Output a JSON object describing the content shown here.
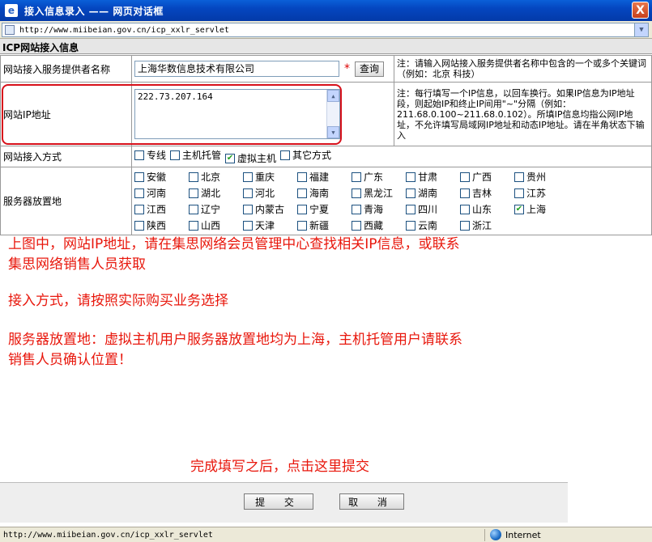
{
  "window": {
    "title": "接入信息录入  —— 网页对话框",
    "close_glyph": "X"
  },
  "address": {
    "url": "http://www.miibeian.gov.cn/icp_xxlr_servlet"
  },
  "form": {
    "section_title": "ICP网站接入信息",
    "provider": {
      "label": "网站接入服务提供者名称",
      "value": "上海华数信息技术有限公司",
      "required_mark": "*",
      "query_button": "查询",
      "note": "注：请输入网站接入服务提供者名称中包含的一个或多个关键词（例如：北京 科技）"
    },
    "ip": {
      "label": "网站IP地址",
      "value": "222.73.207.164",
      "note": "注：每行填写一个IP信息，以回车换行。如果IP信息为IP地址段，则起始IP和终止IP间用\"~\"分隔（例如：211.68.0.100~211.68.0.102）。所填IP信息均指公网IP地址，不允许填写局域网IP地址和动态IP地址。请在半角状态下输入"
    },
    "access_method": {
      "label": "网站接入方式",
      "options": [
        {
          "label": "专线",
          "checked": false
        },
        {
          "label": "主机托管",
          "checked": false
        },
        {
          "label": "虚拟主机",
          "checked": true
        },
        {
          "label": "其它方式",
          "checked": false
        }
      ]
    },
    "server_location": {
      "label": "服务器放置地",
      "options": [
        {
          "label": "安徽",
          "checked": false
        },
        {
          "label": "北京",
          "checked": false
        },
        {
          "label": "重庆",
          "checked": false
        },
        {
          "label": "福建",
          "checked": false
        },
        {
          "label": "广东",
          "checked": false
        },
        {
          "label": "甘肃",
          "checked": false
        },
        {
          "label": "广西",
          "checked": false
        },
        {
          "label": "贵州",
          "checked": false
        },
        {
          "label": "河南",
          "checked": false
        },
        {
          "label": "湖北",
          "checked": false
        },
        {
          "label": "河北",
          "checked": false
        },
        {
          "label": "海南",
          "checked": false
        },
        {
          "label": "黑龙江",
          "checked": false
        },
        {
          "label": "湖南",
          "checked": false
        },
        {
          "label": "吉林",
          "checked": false
        },
        {
          "label": "江苏",
          "checked": false
        },
        {
          "label": "江西",
          "checked": false
        },
        {
          "label": "辽宁",
          "checked": false
        },
        {
          "label": "内蒙古",
          "checked": false
        },
        {
          "label": "宁夏",
          "checked": false
        },
        {
          "label": "青海",
          "checked": false
        },
        {
          "label": "四川",
          "checked": false
        },
        {
          "label": "山东",
          "checked": false
        },
        {
          "label": "上海",
          "checked": true
        },
        {
          "label": "陕西",
          "checked": false
        },
        {
          "label": "山西",
          "checked": false
        },
        {
          "label": "天津",
          "checked": false
        },
        {
          "label": "新疆",
          "checked": false
        },
        {
          "label": "西藏",
          "checked": false
        },
        {
          "label": "云南",
          "checked": false
        },
        {
          "label": "浙江",
          "checked": false
        }
      ]
    }
  },
  "annotations": {
    "ip_line1": "上图中，网站IP地址，请在集思网络会员管理中心查找相关IP信息，或联系",
    "ip_line2": "集思网络销售人员获取",
    "method": "接入方式，请按照实际购买业务选择",
    "location_line1": "服务器放置地：虚拟主机用户服务器放置地均为上海，主机托管用户请联系",
    "location_line2": "销售人员确认位置！",
    "submit_hint": "完成填写之后，点击这里提交"
  },
  "buttons": {
    "submit": "提 交",
    "cancel": "取 消"
  },
  "status": {
    "url": "http://www.miibeian.gov.cn/icp_xxlr_servlet",
    "zone": "Internet"
  },
  "colors": {
    "title_bar": "#0446c0",
    "annotation": "#e8170c",
    "highlight": "#d7101a"
  }
}
